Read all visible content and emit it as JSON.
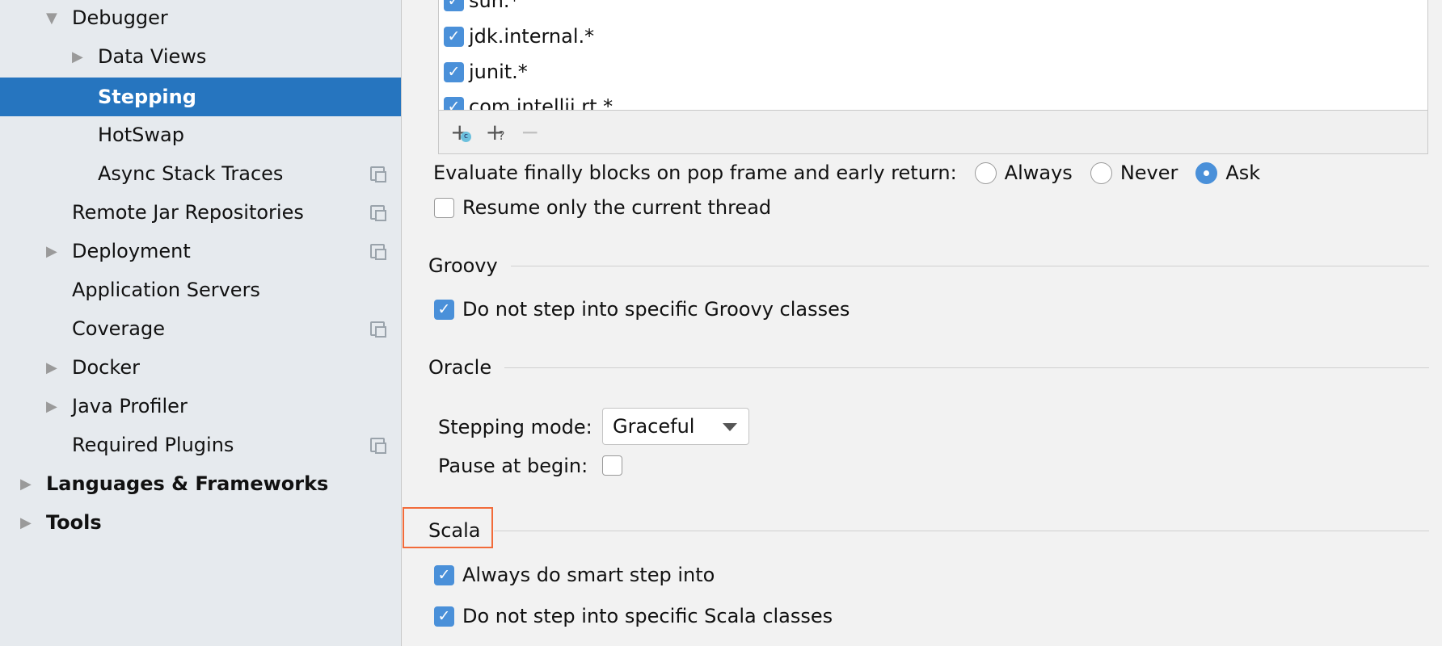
{
  "sidebar": {
    "items": [
      {
        "label": "Debugger",
        "expanded": true
      },
      {
        "label": "Data Views",
        "expanded": false
      },
      {
        "label": "Stepping",
        "selected": true
      },
      {
        "label": "HotSwap"
      },
      {
        "label": "Async Stack Traces",
        "copy_icon": true
      },
      {
        "label": "Remote Jar Repositories",
        "copy_icon": true
      },
      {
        "label": "Deployment",
        "expanded": false,
        "copy_icon": true
      },
      {
        "label": "Application Servers"
      },
      {
        "label": "Coverage",
        "copy_icon": true
      },
      {
        "label": "Docker",
        "expanded": false
      },
      {
        "label": "Java Profiler",
        "expanded": false
      },
      {
        "label": "Required Plugins",
        "copy_icon": true
      },
      {
        "label": "Languages & Frameworks",
        "expanded": false
      },
      {
        "label": "Tools",
        "expanded": false
      }
    ],
    "selected_color": "#2675bf"
  },
  "filters": {
    "items": [
      "sun.*",
      "jdk.internal.*",
      "junit.*",
      "com.intellij.rt.*"
    ],
    "toolbar": {
      "add_class_icon": "add-class-icon",
      "add_pattern_icon": "add-pattern-icon",
      "remove_icon": "remove-icon"
    }
  },
  "evaluate_finally": {
    "label": "Evaluate finally blocks on pop frame and early return:",
    "options": [
      "Always",
      "Never",
      "Ask"
    ],
    "selected": "Ask"
  },
  "resume_thread": {
    "label": "Resume only the current thread",
    "checked": false
  },
  "groovy": {
    "title": "Groovy",
    "option": {
      "label": "Do not step into specific Groovy classes",
      "checked": true
    }
  },
  "oracle": {
    "title": "Oracle",
    "stepping_mode_label": "Stepping mode:",
    "stepping_mode_value": "Graceful",
    "pause_label": "Pause at begin:",
    "pause_checked": false
  },
  "scala": {
    "title": "Scala",
    "options": [
      {
        "label": "Always do smart step into",
        "checked": true
      },
      {
        "label": "Do not step into specific Scala classes",
        "checked": true
      }
    ],
    "highlight_color": "#f26b3a"
  }
}
